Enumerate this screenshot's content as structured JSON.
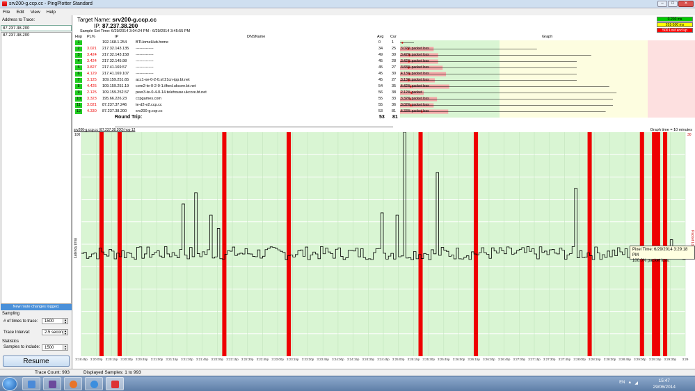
{
  "window": {
    "title": "srv200-g.ccp.cc - PingPlotter Standard",
    "min": "–",
    "max": "□",
    "close": "✕"
  },
  "menu": [
    "File",
    "Edit",
    "View",
    "Help"
  ],
  "left": {
    "address_label": "Address to Trace:",
    "address_value": "87.237.38.200",
    "history": [
      "87.237.38.200"
    ],
    "route_note": "New route changes logged.",
    "sampling_label": "Sampling",
    "times_label": "# of times to trace:",
    "times_value": "1500",
    "interval_label": "Trace Interval:",
    "interval_value": "2.5 seconds",
    "statistics_label": "Statistics",
    "samples_label": "Samples to include:",
    "samples_value": "1500",
    "resume": "Resume"
  },
  "header": {
    "target_label": "Target Name:",
    "target_value": "srv200-g.ccp.cc",
    "ip_label": "IP:",
    "ip_value": "87.237.38.200",
    "sample_time": "Sample Set Time:  6/29/2014 3:04:24 PM - 6/29/2014 3:45:55 PM"
  },
  "legend": [
    {
      "label": "0-200 ms",
      "color": "#00cc00"
    },
    {
      "label": "201-500 ms",
      "color": "#ffff00"
    },
    {
      "label": "500 Lost and up",
      "color": "#ff0000"
    }
  ],
  "table": {
    "columns": {
      "hop": "Hop",
      "pl": "PL%",
      "ip": "IP",
      "dns": "DNSName",
      "avg": "Avg",
      "cur": "Cur",
      "graph": "Graph"
    },
    "rows": [
      {
        "hop": "1",
        "pl": "",
        "ip": "192.168.1.254",
        "dns": "BTHomeHub.home",
        "avg": "0",
        "cur": "1",
        "loss": ""
      },
      {
        "hop": "2",
        "pl": "3.021",
        "ip": "217.32.143.135",
        "dns": "--------------",
        "avg": "34",
        "cur": "25",
        "loss": "3.02% packet loss"
      },
      {
        "hop": "3",
        "pl": "3.424",
        "ip": "217.32.143.158",
        "dns": "--------------",
        "avg": "49",
        "cur": "30",
        "loss": "3.42% packet loss"
      },
      {
        "hop": "4",
        "pl": "3.424",
        "ip": "217.32.145.98",
        "dns": "--------------",
        "avg": "45",
        "cur": "28",
        "loss": "3.42% packet loss"
      },
      {
        "hop": "5",
        "pl": "3.827",
        "ip": "217.41.169.57",
        "dns": "--------------",
        "avg": "45",
        "cur": "27",
        "loss": "3.83% packet loss"
      },
      {
        "hop": "6",
        "pl": "4.129",
        "ip": "217.41.169.107",
        "dns": "--------------",
        "avg": "45",
        "cur": "30",
        "loss": "4.13% packet loss"
      },
      {
        "hop": "7",
        "pl": "3.125",
        "ip": "109.159.251.65",
        "dns": "acc1-xe-0-2-0.sf.21cn-ipp.bt.net",
        "avg": "45",
        "cur": "27",
        "loss": "3.13% packet loss"
      },
      {
        "hop": "8",
        "pl": "4.425",
        "ip": "109.159.251.19",
        "dns": "core2-te-0-2-0-1.ilford.ukcore.bt.net",
        "avg": "54",
        "cur": "35",
        "loss": "4.42% packet loss"
      },
      {
        "hop": "9",
        "pl": "2.125",
        "ip": "109.159.252.57",
        "dns": "peer3-te-0-4-0-14.telehouse.ukcore.bt.net",
        "avg": "56",
        "cur": "38",
        "loss": "2.12% packet"
      },
      {
        "hop": "10",
        "pl": "3.323",
        "ip": "195.66.226.23",
        "dns": "ccpgames.com",
        "avg": "55",
        "cur": "33",
        "loss": "3.32% packet loss"
      },
      {
        "hop": "11",
        "pl": "3.021",
        "ip": "87.237.37.246",
        "dns": "te-d2-e2.ccp.cc",
        "avg": "55",
        "cur": "36",
        "loss": "3.02% packet loss"
      },
      {
        "hop": "12",
        "pl": "4.330",
        "ip": "87.237.38.200",
        "dns": "srv200-g.ccp.cc",
        "avg": "53",
        "cur": "81",
        "loss": "4.33% packet loss"
      }
    ],
    "round_trip_label": "Round Trip:",
    "round_trip_avg": "53",
    "round_trip_cur": "81"
  },
  "graph": {
    "title": "srv200-g.ccp.cc (87.237.38.200) hop 12",
    "time_label": "Graph time = 10 minutes",
    "ylabel": "Latency (ms)",
    "y_top": "100",
    "y_right_top": "30",
    "y_right_mid": "Packet Loss %",
    "xticks": [
      "3:19:45p",
      "3:20:00p",
      "3:20:15p",
      "3:20:30p",
      "3:20:45p",
      "3:21:00p",
      "3:21:15p",
      "3:21:30p",
      "3:21:45p",
      "3:22:00p",
      "3:22:15p",
      "3:22:30p",
      "3:22:45p",
      "3:23:00p",
      "3:23:15p",
      "3:23:30p",
      "3:23:45p",
      "3:24:00p",
      "3:24:15p",
      "3:24:30p",
      "3:24:45p",
      "3:25:00p",
      "3:25:15p",
      "3:25:30p",
      "3:25:45p",
      "3:26:00p",
      "3:26:15p",
      "3:26:30p",
      "3:26:45p",
      "3:27:00p",
      "3:27:15p",
      "3:27:30p",
      "3:27:45p",
      "3:28:00p",
      "3:28:15p",
      "3:28:30p",
      "3:28:45p",
      "3:29:00p",
      "3:29:15p",
      "3:29:30p",
      "3:29"
    ]
  },
  "chart_data": {
    "type": "line",
    "xlabel": "",
    "ylabel": "Latency (ms)",
    "ylim": [
      0,
      100
    ],
    "loss_times": [
      "3:20:05p",
      "3:20:23p",
      "3:22:07p",
      "3:23:11p",
      "3:25:22p",
      "3:26:17p",
      "3:28:10p",
      "3:29:02p",
      "3:29:14p",
      "3:29:18p",
      "3:29:25p"
    ],
    "spikes": [
      {
        "x": "3:21:26p",
        "y": 68
      },
      {
        "x": "3:21:37p",
        "y": 73
      },
      {
        "x": "3:21:52p",
        "y": 63
      },
      {
        "x": "3:22:00p",
        "y": 57
      },
      {
        "x": "3:24:42p",
        "y": 64
      },
      {
        "x": "3:24:58p",
        "y": 63
      },
      {
        "x": "3:25:05p",
        "y": 100
      },
      {
        "x": "3:25:38p",
        "y": 82
      },
      {
        "x": "3:27:55p",
        "y": 75
      },
      {
        "x": "3:29:30p",
        "y": 52
      }
    ],
    "baseline_ms": 46
  },
  "tooltip": {
    "line1": "Pixel Time: 6/29/2014 3:29:18 PM",
    "line2": "100.0% packet loss."
  },
  "status": {
    "trace_count": "Trace Count: 993",
    "displayed": "Displayed Samples: 1 to 993"
  },
  "taskbar": {
    "time": "15:47",
    "date": "29/06/2014",
    "lang": "EN"
  }
}
